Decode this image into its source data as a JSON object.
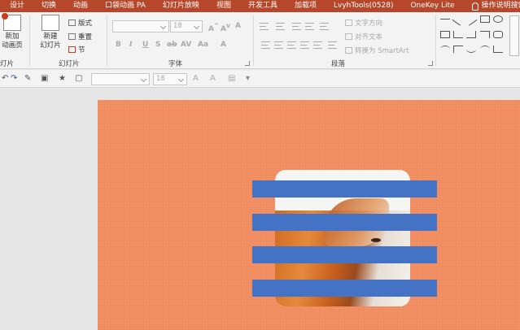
{
  "tabs": [
    "设计",
    "切换",
    "动画",
    "口袋动画 PA",
    "幻灯片放映",
    "视图",
    "开发工具",
    "加载项",
    "LvyhTools(0528)",
    "OneKey Lite"
  ],
  "help_tab": "操作说明搜索",
  "ribbon": {
    "new_animation_page": [
      "新加",
      "动画页"
    ],
    "new_slide": [
      "新建",
      "幻灯片"
    ],
    "layout": "版式",
    "reset": "重置",
    "section": "节",
    "slides_group_label": "幻灯片",
    "font_size": "18",
    "font_group_label": "字体",
    "font_buttons": [
      "B",
      "I",
      "U",
      "S",
      "ab",
      "AV",
      "Aa",
      "A"
    ],
    "text_direction": "文字方向",
    "align_text": "对齐文本",
    "convert_smartart": "转换为 SmartArt",
    "paragraph_group_label": "段落"
  },
  "qat": {
    "font_size": "18"
  },
  "colors": {
    "ribbon_tab_bg": "#b7472a",
    "slide_bg": "#f08b5e",
    "stripe": "#4472c4"
  }
}
